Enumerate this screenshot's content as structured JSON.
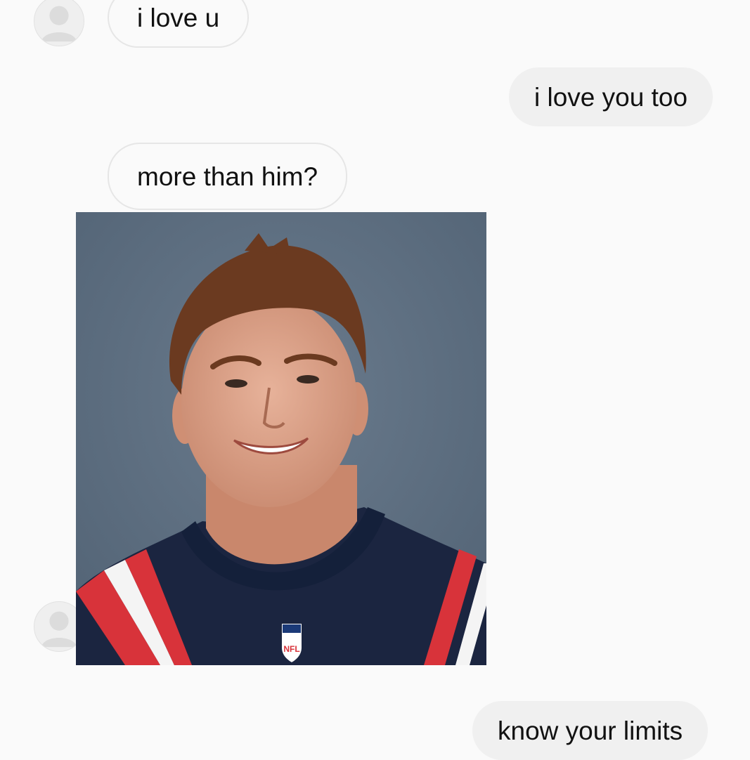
{
  "conversation": {
    "messages": [
      {
        "direction": "incoming",
        "text": "i love u"
      },
      {
        "direction": "outgoing",
        "text": "i love you too"
      },
      {
        "direction": "incoming",
        "text": "more than him?"
      },
      {
        "direction": "incoming",
        "attachment": "photo",
        "description": "portrait of a smiling man in a navy football jersey"
      },
      {
        "direction": "outgoing",
        "text": "know your limits"
      }
    ]
  },
  "photo": {
    "jersey_badge_text": "NFL"
  },
  "colors": {
    "background": "#fafafa",
    "incoming_bubble": "#fafafa",
    "incoming_border": "#e6e6e6",
    "outgoing_bubble": "#f0f0f0",
    "photo_backdrop": "#5d6e80",
    "jersey_navy": "#1b2540",
    "jersey_red": "#d8333a"
  },
  "icons": {
    "avatar": "default-user-avatar-icon"
  }
}
